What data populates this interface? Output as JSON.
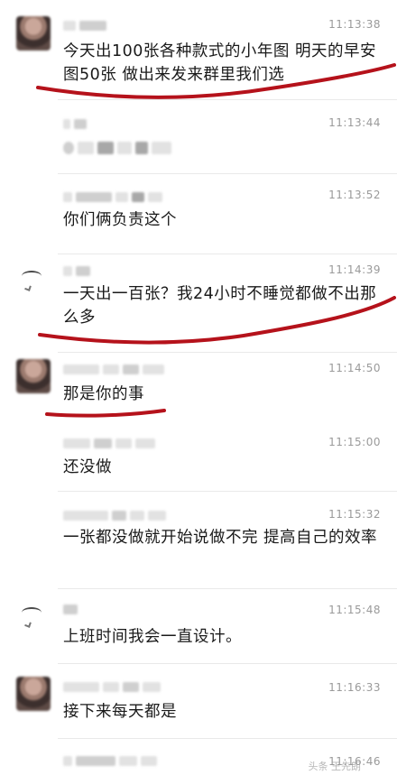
{
  "messages": [
    {
      "time": "11:13:38",
      "text": "今天出100张各种款式的小年图 明天的早安图50张 做出来发来群里我们选"
    },
    {
      "time": "11:13:44",
      "text": ""
    },
    {
      "time": "11:13:52",
      "text": "你们俩负责这个"
    },
    {
      "time": "11:14:39",
      "text": "一天出一百张？我24小时不睡觉都做不出那么多"
    },
    {
      "time": "11:14:50",
      "text": "那是你的事"
    },
    {
      "time": "11:15:00",
      "text": "还没做"
    },
    {
      "time": "11:15:32",
      "text": "一张都没做就开始说做不完 提高自己的效率"
    },
    {
      "time": "11:15:48",
      "text": "上班时间我会一直设计。"
    },
    {
      "time": "11:16:33",
      "text": "接下来每天都是"
    },
    {
      "time": "11:16:46",
      "text": ""
    }
  ],
  "watermark": "头条 王先朗",
  "colors": {
    "annotation_red": "#b5121b",
    "time_gray": "#9a9a9a"
  }
}
